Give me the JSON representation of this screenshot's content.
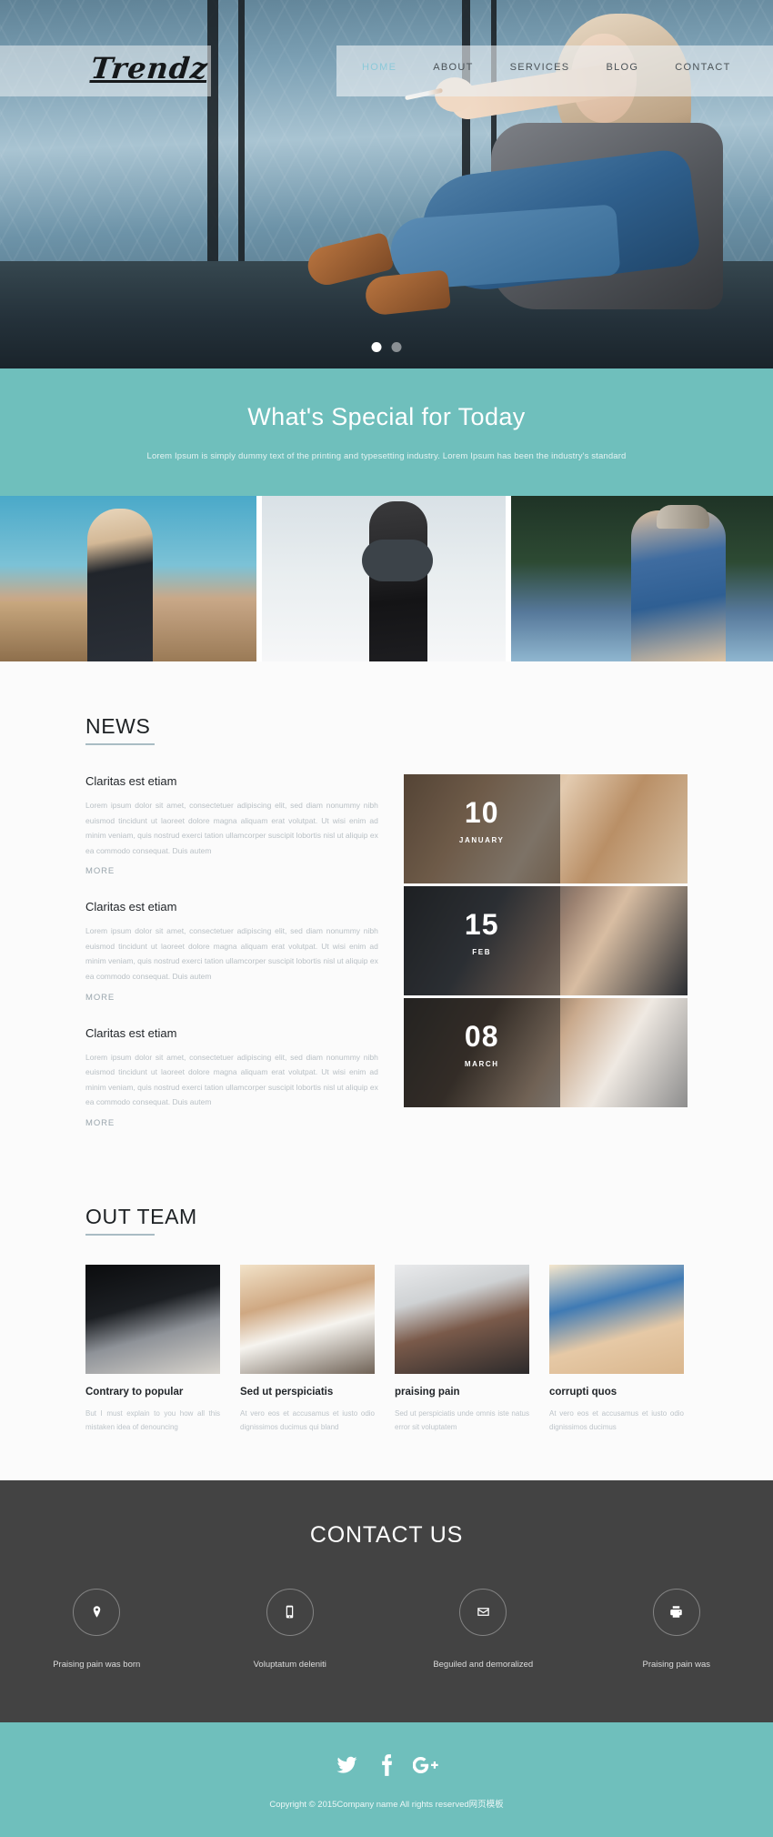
{
  "header": {
    "logo": "Trendz",
    "nav": [
      {
        "label": "HOME",
        "active": true
      },
      {
        "label": "ABOUT",
        "active": false
      },
      {
        "label": "SERVICES",
        "active": false
      },
      {
        "label": "BLOG",
        "active": false
      },
      {
        "label": "CONTACT",
        "active": false
      }
    ],
    "carousel": {
      "slides": 2,
      "active_index": 0
    }
  },
  "special": {
    "title": "What's Special for Today",
    "subtitle": "Lorem Ipsum is simply dummy text of the printing and typesetting industry. Lorem Ipsum has been the industry's standard"
  },
  "gallery": {
    "items": [
      {
        "alt": "blonde-woman-with-scarf-on-rooftop"
      },
      {
        "alt": "man-with-dark-scarf-and-coat"
      },
      {
        "alt": "woman-sitting-on-skateboard"
      }
    ]
  },
  "news": {
    "title": "NEWS",
    "items": [
      {
        "heading": "Claritas est etiam",
        "body": "Lorem ipsum dolor sit amet, consectetuer adipiscing elit, sed diam nonummy nibh euismod tincidunt ut laoreet dolore magna aliquam erat volutpat. Ut wisi enim ad minim veniam, quis nostrud exerci tation ullamcorper suscipit lobortis nisl ut aliquip ex ea commodo consequat. Duis autem",
        "more": "MORE"
      },
      {
        "heading": "Claritas est etiam",
        "body": "Lorem ipsum dolor sit amet, consectetuer adipiscing elit, sed diam nonummy nibh euismod tincidunt ut laoreet dolore magna aliquam erat volutpat. Ut wisi enim ad minim veniam, quis nostrud exerci tation ullamcorper suscipit lobortis nisl ut aliquip ex ea commodo consequat. Duis autem",
        "more": "MORE"
      },
      {
        "heading": "Claritas est etiam",
        "body": "Lorem ipsum dolor sit amet, consectetuer adipiscing elit, sed diam nonummy nibh euismod tincidunt ut laoreet dolore magna aliquam erat volutpat. Ut wisi enim ad minim veniam, quis nostrud exerci tation ullamcorper suscipit lobortis nisl ut aliquip ex ea commodo consequat. Duis autem",
        "more": "MORE"
      }
    ],
    "date_cards": [
      {
        "day": "10",
        "month": "JANUARY"
      },
      {
        "day": "15",
        "month": "FEB"
      },
      {
        "day": "08",
        "month": "MARCH"
      }
    ]
  },
  "team": {
    "title": "OUT TEAM",
    "members": [
      {
        "name": "Contrary to popular",
        "desc": "But I must explain to you how all this mistaken idea of denouncing"
      },
      {
        "name": "Sed ut perspiciatis",
        "desc": "At vero eos et accusamus et iusto odio dignissimos ducimus qui bland"
      },
      {
        "name": "praising pain",
        "desc": "Sed ut perspiciatis unde omnis iste natus error sit voluptatem"
      },
      {
        "name": "corrupti quos",
        "desc": "At vero eos et accusamus et iusto odio dignissimos ducimus"
      }
    ]
  },
  "contact": {
    "title": "CONTACT US",
    "items": [
      {
        "icon": "map-pin-icon",
        "label": "Praising pain was born"
      },
      {
        "icon": "mobile-phone-icon",
        "label": "Voluptatum deleniti"
      },
      {
        "icon": "envelope-icon",
        "label": "Beguiled and demoralized"
      },
      {
        "icon": "printer-icon",
        "label": "Praising pain was"
      }
    ]
  },
  "footer": {
    "social": [
      {
        "icon": "twitter-icon",
        "name": "Twitter"
      },
      {
        "icon": "facebook-icon",
        "name": "Facebook"
      },
      {
        "icon": "google-plus-icon",
        "name": "Google Plus"
      }
    ],
    "copyright": "Copyright © 2015Company name All rights reserved网页模板"
  },
  "colors": {
    "teal": "#6fbfbc",
    "dark": "#434343",
    "nav_active": "#8cc9d9",
    "rule": "#a9bcc4"
  }
}
